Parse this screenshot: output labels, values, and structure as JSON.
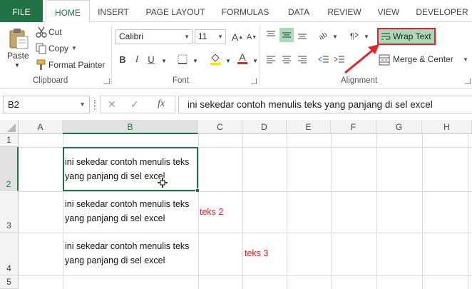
{
  "tabs": [
    "FILE",
    "HOME",
    "INSERT",
    "PAGE LAYOUT",
    "FORMULAS",
    "DATA",
    "REVIEW",
    "VIEW",
    "DEVELOPER"
  ],
  "active_tab": "HOME",
  "clipboard": {
    "paste": "Paste",
    "cut": "Cut",
    "copy": "Copy",
    "format_painter": "Format Painter",
    "label": "Clipboard"
  },
  "font": {
    "name": "Calibri",
    "size": "11",
    "bold": "B",
    "italic": "I",
    "underline": "U",
    "font_color_glyph": "A",
    "label": "Font"
  },
  "alignment": {
    "wrap_text": "Wrap Text",
    "merge_center": "Merge & Center",
    "label": "Alignment"
  },
  "formula_bar": {
    "name_box": "B2",
    "fx": "fx",
    "cancel": "✕",
    "enter": "✓",
    "content": "ini sekedar contoh menulis teks yang panjang di sel excel"
  },
  "columns": [
    "A",
    "B",
    "C",
    "D",
    "E",
    "F",
    "G",
    "H"
  ],
  "selected_column": "B",
  "rows": [
    "1",
    "2",
    "3",
    "4",
    "5"
  ],
  "selected_row": "2",
  "cells": {
    "b2_line1": "ini sekedar contoh menulis teks",
    "b2_line2": "yang panjang di sel excel",
    "b3_line1": "ini sekedar contoh menulis teks",
    "b3_line2": "yang panjang di sel excel",
    "c3": "teks 2",
    "b4_line1": "ini sekedar contoh menulis teks",
    "b4_line2": "yang panjang di sel excel",
    "d4": "teks 3"
  },
  "colors": {
    "accent": "#217346",
    "highlight_box": "#e3242b",
    "annotation_text": "#e02020",
    "wrap_active": "#a9d9b6"
  }
}
